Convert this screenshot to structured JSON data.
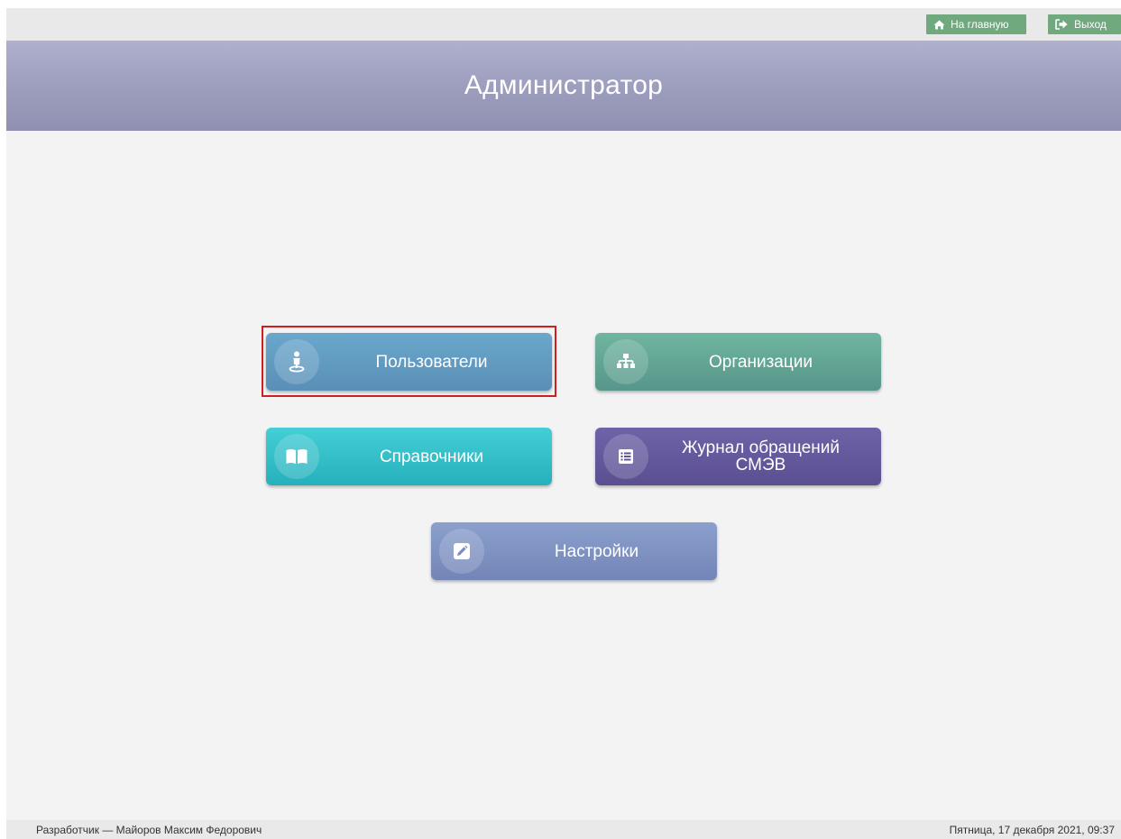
{
  "topbar": {
    "home_label": "На главную",
    "exit_label": "Выход"
  },
  "header": {
    "title": "Администратор"
  },
  "tiles": {
    "users": {
      "label": "Пользователи",
      "icon": "user-pin-icon"
    },
    "organizations": {
      "label": "Организации",
      "icon": "org-structure-icon"
    },
    "references": {
      "label": "Справочники",
      "icon": "book-icon"
    },
    "journal": {
      "label": "Журнал обращений\nСМЭВ",
      "icon": "list-icon"
    },
    "settings": {
      "label": "Настройки",
      "icon": "pencil-icon"
    }
  },
  "footer": {
    "developer": "Разработчик — Майоров Максим Федорович",
    "datetime": "Пятница, 17 декабря 2021, 09:37"
  },
  "colors": {
    "users_tile": "#5f9cc2",
    "organizations_tile": "#64a695",
    "references_tile": "#33bfc8",
    "journal_tile": "#65599d",
    "settings_tile": "#7f93c2",
    "header": "#9c9dbd",
    "top_buttons": "#71a97f",
    "highlight": "#cc1f1f"
  }
}
